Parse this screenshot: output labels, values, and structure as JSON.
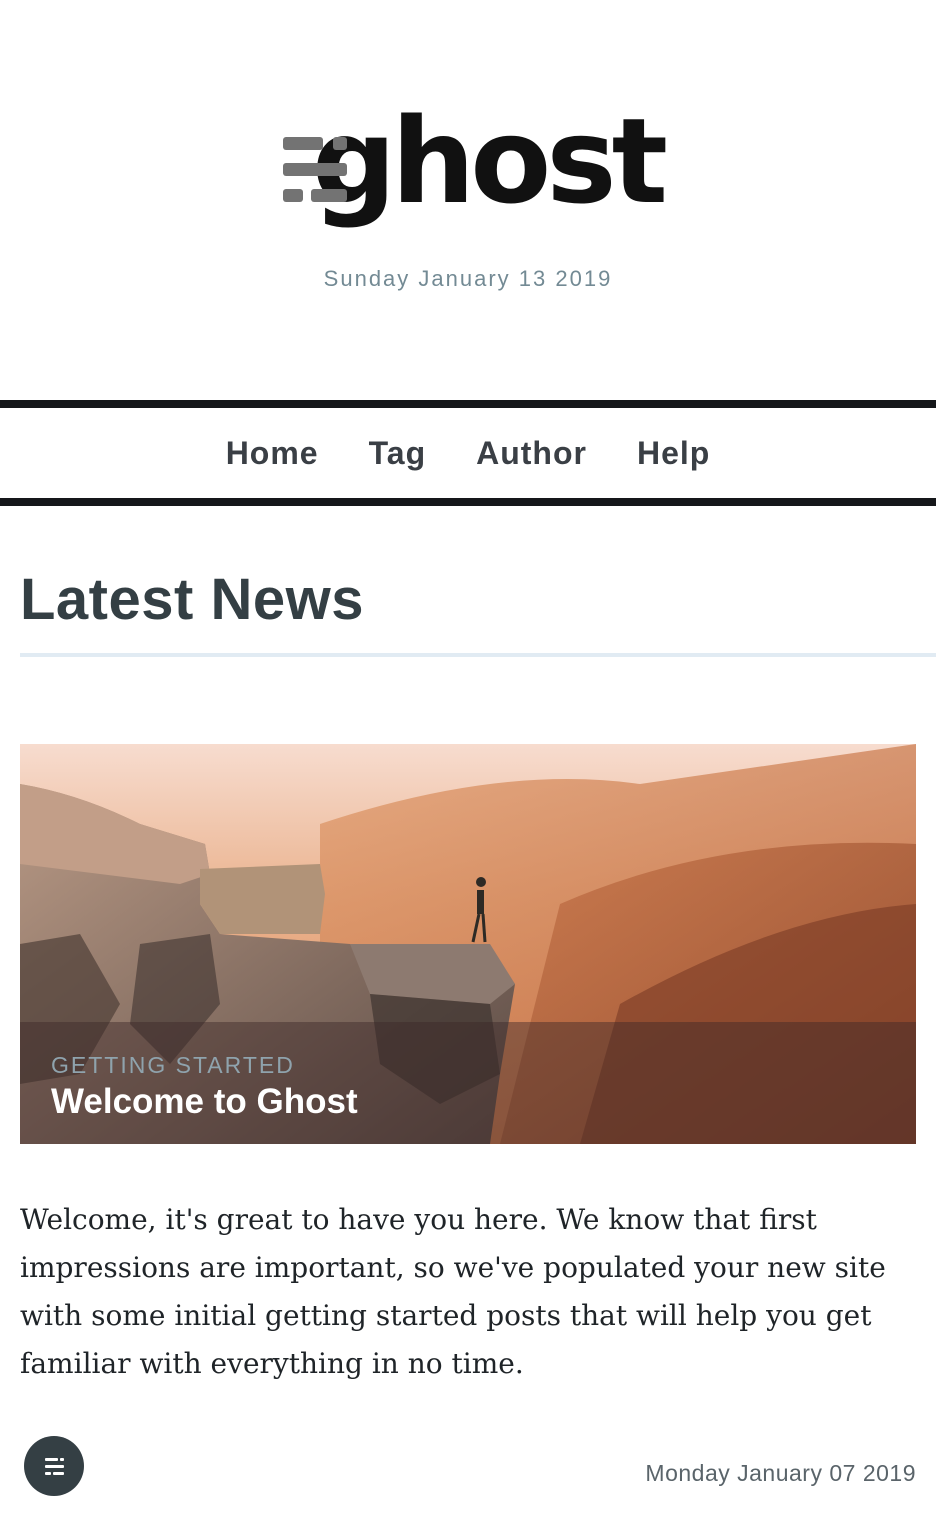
{
  "header": {
    "brand": "ghost",
    "date": "Sunday January 13 2019"
  },
  "nav": {
    "items": [
      {
        "label": "Home"
      },
      {
        "label": "Tag"
      },
      {
        "label": "Author"
      },
      {
        "label": "Help"
      }
    ]
  },
  "section": {
    "title": "Latest News"
  },
  "feature": {
    "tag": "GETTING STARTED",
    "title": "Welcome to Ghost",
    "image_icon": "cliff-landscape-image"
  },
  "post": {
    "excerpt": "Welcome, it's great to have you here. We know that first impressions are important, so we've populated your new site with some initial getting started posts that will help you get familiar with everything in no time.",
    "date": "Monday January 07 2019"
  },
  "fab": {
    "icon": "ghost-logo-icon"
  },
  "colors": {
    "accent": "#15171a",
    "heading": "#343f44",
    "muted": "#738a94"
  }
}
